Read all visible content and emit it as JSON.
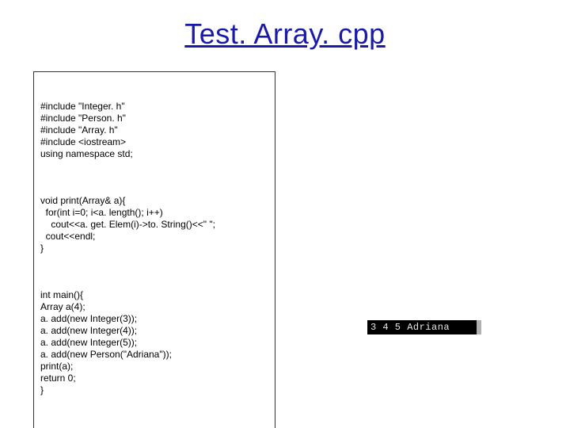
{
  "title": "Test. Array. cpp",
  "code": {
    "block1": "#include \"Integer. h\"\n#include \"Person. h\"\n#include \"Array. h\"\n#include <iostream>\nusing namespace std;",
    "block2": "void print(Array& a){\n  for(int i=0; i<a. length(); i++)\n    cout<<a. get. Elem(i)->to. String()<<\" \";\n  cout<<endl;\n}",
    "block3": "int main(){\nArray a(4);\na. add(new Integer(3));\na. add(new Integer(4));\na. add(new Integer(5));\na. add(new Person(\"Adriana\"));\nprint(a);\nreturn 0;\n}"
  },
  "output": "3 4 5 Adriana"
}
